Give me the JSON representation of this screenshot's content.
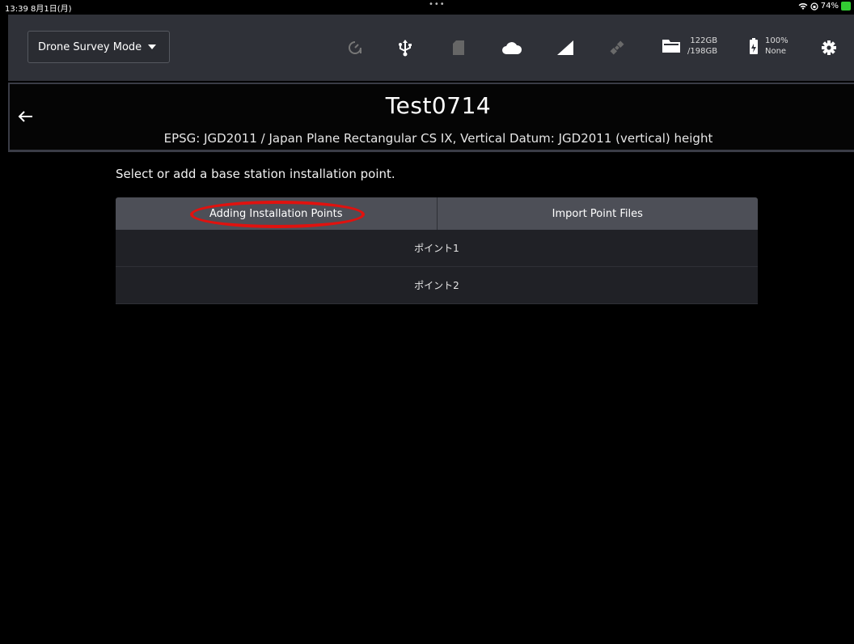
{
  "statusbar": {
    "time": "13:39  8月1日(月)",
    "dots": "•••",
    "battery_percent": "74%"
  },
  "toolbar": {
    "mode_label": "Drone Survey Mode",
    "storage": {
      "used": "122GB",
      "total": "/198GB"
    },
    "battery": {
      "percent": "100%",
      "status": "None"
    },
    "icons": [
      "timer-icon",
      "usb-icon",
      "sd-card-icon",
      "cloud-icon",
      "signal-icon",
      "satellite-icon",
      "folder-icon",
      "battery-icon",
      "gear-icon"
    ]
  },
  "header": {
    "title": "Test0714",
    "subtitle": "EPSG: JGD2011 / Japan Plane Rectangular CS IX, Vertical Datum: JGD2011 (vertical) height"
  },
  "content": {
    "instruction": "Select or add a base station installation point.",
    "tabs": [
      {
        "label": "Adding Installation Points",
        "highlighted": true
      },
      {
        "label": "Import Point Files",
        "highlighted": false
      }
    ],
    "points": [
      {
        "label": "ポイント1"
      },
      {
        "label": "ポイント2"
      }
    ]
  },
  "colors": {
    "toolbar_bg": "#2f3138",
    "tab_bg": "#4d4f57",
    "highlight": "#e0120f",
    "battery_green": "#33cc33"
  }
}
